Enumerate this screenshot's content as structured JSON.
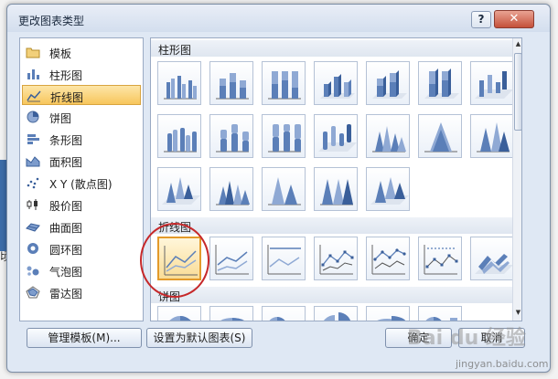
{
  "dialog": {
    "title": "更改图表类型",
    "help_label": "?",
    "close_label": "✕"
  },
  "background": {
    "partial_text": "顷"
  },
  "categories": [
    {
      "label": "模板",
      "icon": "folder-icon"
    },
    {
      "label": "柱形图",
      "icon": "column-chart-icon"
    },
    {
      "label": "折线图",
      "icon": "line-chart-icon",
      "selected": true
    },
    {
      "label": "饼图",
      "icon": "pie-chart-icon"
    },
    {
      "label": "条形图",
      "icon": "bar-chart-icon"
    },
    {
      "label": "面积图",
      "icon": "area-chart-icon"
    },
    {
      "label": "X Y (散点图)",
      "icon": "scatter-chart-icon"
    },
    {
      "label": "股价图",
      "icon": "stock-chart-icon"
    },
    {
      "label": "曲面图",
      "icon": "surface-chart-icon"
    },
    {
      "label": "圆环图",
      "icon": "doughnut-chart-icon"
    },
    {
      "label": "气泡图",
      "icon": "bubble-chart-icon"
    },
    {
      "label": "雷达图",
      "icon": "radar-chart-icon"
    }
  ],
  "sections": {
    "column": "柱形图",
    "line": "折线图",
    "pie": "饼图"
  },
  "buttons": {
    "manage_templates": "管理模板(M)...",
    "set_default": "设置为默认图表(S)",
    "ok": "确定",
    "cancel": "取消"
  },
  "watermark": {
    "logo": "Bai du 经验",
    "url": "jingyan.baidu.com"
  },
  "colors": {
    "selection": "#f7c65c",
    "highlight_circle": "#c6282a",
    "bar_blue": "#5b7fb8"
  }
}
